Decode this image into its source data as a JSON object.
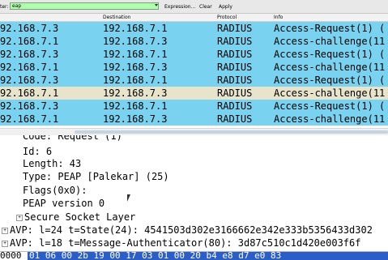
{
  "toolbar": {
    "filter_label": "ter:",
    "filter_value": "eap",
    "buttons": [
      "Expression...",
      "Clear",
      "Apply"
    ]
  },
  "columns": [
    "Destination",
    "Protocol",
    "Info"
  ],
  "packets": [
    {
      "src": "92.168.7.3",
      "dst": "192.168.7.1",
      "proto": "RADIUS",
      "info": "Access-Request(1) (",
      "color": "#78d2f0"
    },
    {
      "src": "92.168.7.1",
      "dst": "192.168.7.3",
      "proto": "RADIUS",
      "info": "Access-challenge(11",
      "color": "#78d2f0"
    },
    {
      "src": "92.168.7.3",
      "dst": "192.168.7.1",
      "proto": "RADIUS",
      "info": "Access-Request(1) (",
      "color": "#78d2f0"
    },
    {
      "src": "92.168.7.1",
      "dst": "192.168.7.3",
      "proto": "RADIUS",
      "info": "Access-challenge(11",
      "color": "#78d2f0"
    },
    {
      "src": "92.168.7.3",
      "dst": "192.168.7.1",
      "proto": "RADIUS",
      "info": "Access-Request(1) (",
      "color": "#78d2f0"
    },
    {
      "src": "92.168.7.1",
      "dst": "192.168.7.3",
      "proto": "RADIUS",
      "info": "Access-challenge(11",
      "color": "#e8e4cc"
    },
    {
      "src": "92.168.7.3",
      "dst": "192.168.7.1",
      "proto": "RADIUS",
      "info": "Access-Request(1) (",
      "color": "#78d2f0"
    },
    {
      "src": "92.168.7.1",
      "dst": "192.168.7.3",
      "proto": "RADIUS",
      "info": "Access-challenge(11",
      "color": "#78d2f0"
    }
  ],
  "details": {
    "code": "Code: Request (1)",
    "id": "Id: 6",
    "length": "Length: 43",
    "type": "Type: PEAP [Palekar] (25)",
    "flags": "Flags(0x0):",
    "peap_version": "PEAP version 0",
    "ssl": "Secure Socket Layer",
    "avp1": "AVP: l=24  t=State(24): 4541503d302e3166662e342e333b5356433d302",
    "avp2": "AVP: l=18  t=Message-Authenticator(80): 3d87c510c1d420e003f6f"
  },
  "hex": {
    "offset": "0000",
    "bytes": "01 06 00 2b 19 00 17 03  01 00 20 b4 e8 d7 e0 83"
  }
}
